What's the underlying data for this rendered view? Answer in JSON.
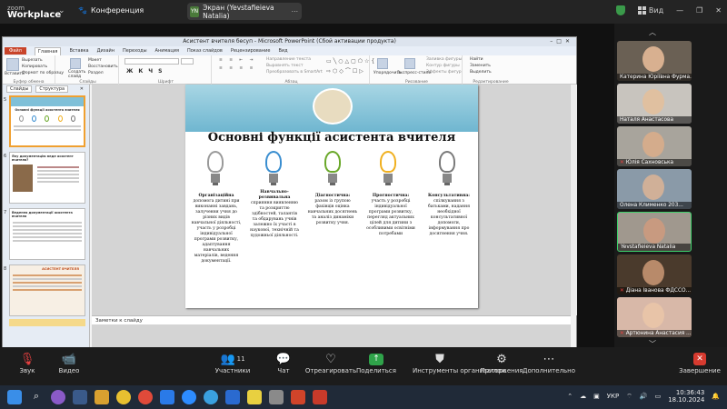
{
  "app": {
    "brand_line1": "zoom",
    "brand_line2": "Workplace",
    "meeting_label": "Конференция"
  },
  "screen_share": {
    "badge": "YN",
    "title": "Экран (Yevstafieieva Natalia)"
  },
  "top_right": {
    "view_label": "Вид"
  },
  "ppt": {
    "title": "Асистент вчителя бесуп - Microsoft PowerPoint (Сбой активации продукта)",
    "tabs": [
      "Файл",
      "Главная",
      "Вставка",
      "Дизайн",
      "Переходы",
      "Анимация",
      "Показ слайдов",
      "Рецензирование",
      "Вид"
    ],
    "ribbon": {
      "clipboard": {
        "paste": "Вставить",
        "cut": "Вырезать",
        "copy": "Копировать",
        "format": "Формат по образцу",
        "label": "Буфер обмена"
      },
      "slides": {
        "new": "Создать слайд",
        "layout": "Макет",
        "reset": "Восстановить",
        "section": "Раздел",
        "label": "Слайды"
      },
      "font": {
        "label": "Шрифт"
      },
      "paragraph": {
        "label": "Абзац",
        "direction": "Направление текста",
        "align": "Выровнять текст",
        "smartart": "Преобразовать в SmartArt"
      },
      "drawing": {
        "arrange": "Упорядочить",
        "styles": "Экспресс-стили",
        "fill": "Заливка фигуры",
        "outline": "Контур фигуры",
        "effects": "Эффекты фигур",
        "label": "Рисование"
      },
      "editing": {
        "find": "Найти",
        "replace": "Заменить",
        "select": "Выделить",
        "label": "Редактирование"
      }
    },
    "left_tabs": [
      "Слайды",
      "Структура"
    ],
    "thumbs": [
      {
        "num": "5",
        "title": "Основні функції асистента вчителя"
      },
      {
        "num": "6",
        "title": "Яку документацію веде асистент вчителя?"
      },
      {
        "num": "7",
        "title": "Ведення документації асистента вчителя"
      },
      {
        "num": "8",
        "title": "АСИСТЕНТ ВЧИТЕЛЯ"
      }
    ],
    "notes": "Заметки к слайду",
    "status": {
      "slide": "Слайд 5 из 9",
      "theme": "\"Тема Office\"",
      "lang": "украинский",
      "zoom": "80%"
    }
  },
  "slide": {
    "title": "Основні функції асистента вчителя",
    "columns": [
      {
        "head": "Організаційна",
        "body": "допомога дитині при виконанні завдань, залучення учня до різних видів навчальної діяльності, участь у розробці індивідуальної програми розвитку, адаптування навчальних матеріалів, ведення документації."
      },
      {
        "head": "Навчально-розвивальна",
        "body": "сприяння виявленню та розкриттю здібностей, талантів та обдарувань учнів залежно їх участі в наукової, технічній та художньої діяльності."
      },
      {
        "head": "Діагностична:",
        "body": "разом із групою фахівців оцінка навчальних досягнень та аналіз динаміки розвитку учня."
      },
      {
        "head": "Прогностична:",
        "body": "участь у розробці індивідуальної програми розвитку, перегляд актуальних цілей для дитини з особливими освітніми потребами"
      },
      {
        "head": "Консультативна:",
        "body": "спілкування з батьками, надання необхідної консультативної допомоги, інформування про досягнення учня."
      }
    ],
    "bulb_colors": [
      "#9a9a9a",
      "#3a8ed0",
      "#6aa82a",
      "#f0b020",
      "#7a7a7a"
    ]
  },
  "participants": [
    {
      "name": "Катерина Юріївна Фурма..."
    },
    {
      "name": "Наталя Анастасова"
    },
    {
      "name": "Юлія Сахновська"
    },
    {
      "name": "Олена Клименко 203..."
    },
    {
      "name": "Yevstafieieva Natalia"
    },
    {
      "name": "Діана Іванова ФДССО..."
    },
    {
      "name": "Артюнина Анастасия ..."
    }
  ],
  "toolbar": {
    "audio": "Звук",
    "video": "Видео",
    "participants": "Участники",
    "participants_count": "11",
    "chat": "Чат",
    "react": "Отреагировать",
    "share": "Поделиться",
    "apps_org": "Инструменты организатора",
    "apps": "Приложения",
    "more": "Дополнительно",
    "end": "Завершение"
  },
  "taskbar": {
    "lang": "УКР",
    "time": "10:36:43",
    "date": "18.10.2024"
  }
}
